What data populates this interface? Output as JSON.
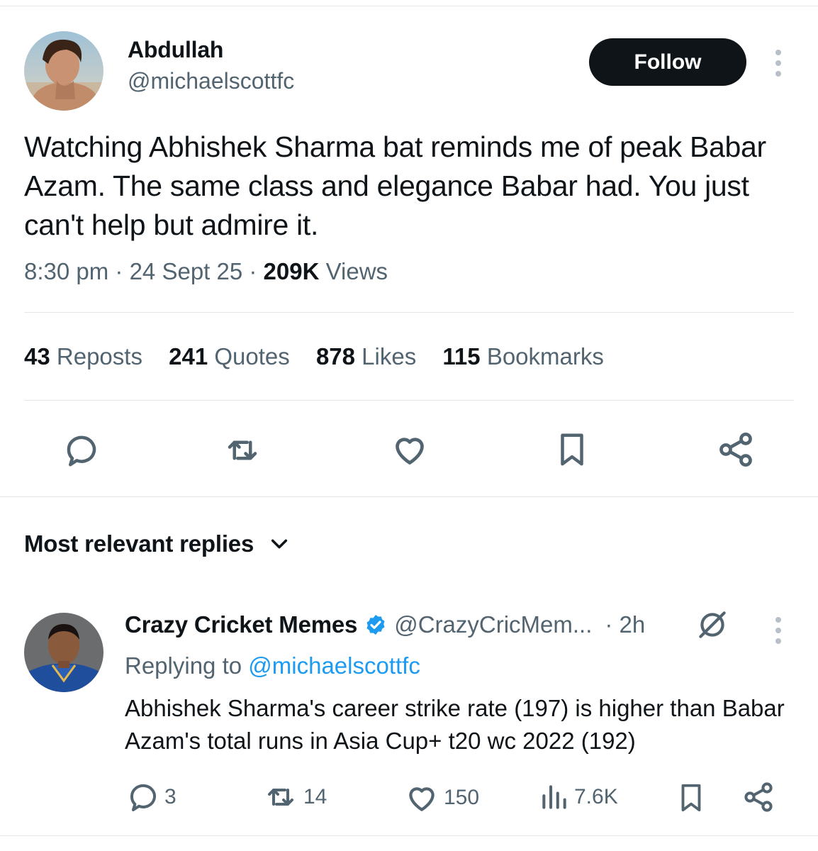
{
  "tweet": {
    "author_name": "Abdullah",
    "author_handle": "@michaelscottfc",
    "follow_label": "Follow",
    "text": "Watching Abhishek Sharma bat reminds me of peak Babar Azam. The same class and elegance Babar had. You just can't help but admire it.",
    "time": "8:30 pm",
    "date": "24 Sept 25",
    "views_count": "209K",
    "views_label": "Views",
    "stats": [
      {
        "count": "43",
        "label": "Reposts"
      },
      {
        "count": "241",
        "label": "Quotes"
      },
      {
        "count": "878",
        "label": "Likes"
      },
      {
        "count": "115",
        "label": "Bookmarks"
      }
    ],
    "actions": [
      "reply-icon",
      "repost-icon",
      "like-icon",
      "bookmark-icon",
      "share-icon"
    ]
  },
  "replies_section": {
    "sort_label": "Most relevant replies"
  },
  "reply": {
    "author_name": "Crazy Cricket Memes",
    "verified": true,
    "author_handle": "@CrazyCricMem...",
    "time": "· 2h",
    "replying_prefix": "Replying to",
    "replying_to": "@michaelscottfc",
    "text": "Abhishek Sharma's career strike rate (197) is higher than Babar Azam's total runs in Asia Cup+ t20 wc 2022 (192)",
    "replies": "3",
    "reposts": "14",
    "likes": "150",
    "views": "7.6K"
  },
  "colors": {
    "text": "#0f1419",
    "secondary": "#536471",
    "link": "#1d9bf0",
    "follow_bg": "#0f1419",
    "divider": "#e3e7ea"
  }
}
